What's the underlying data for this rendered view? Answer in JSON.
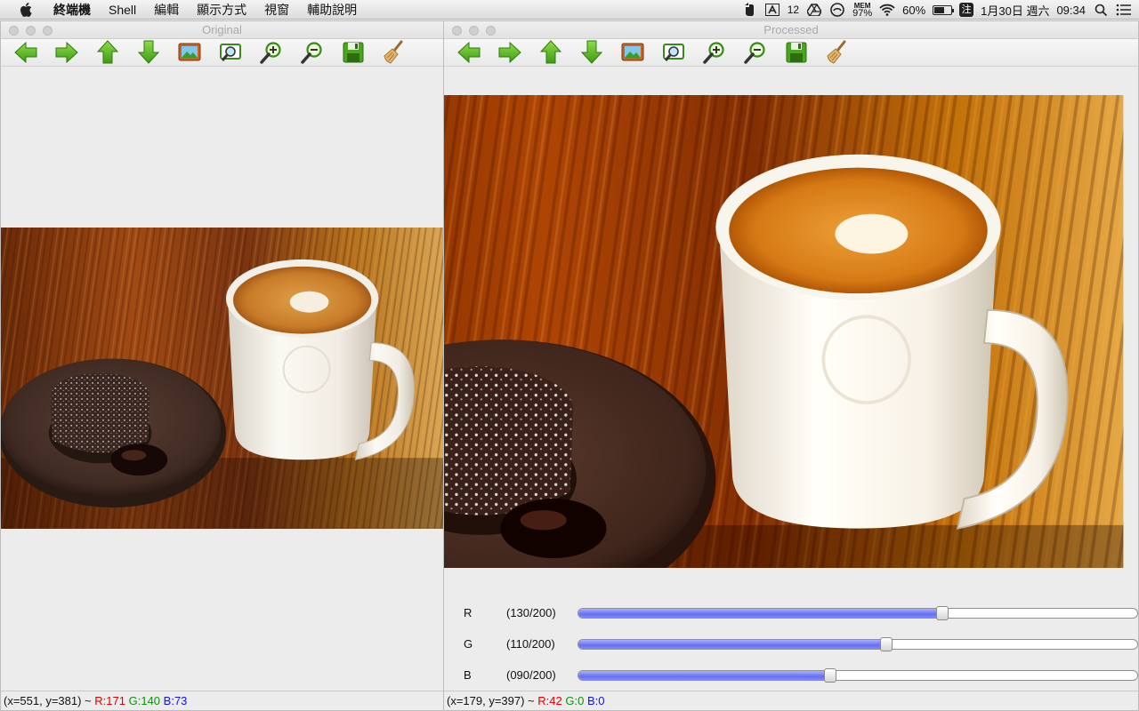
{
  "menubar": {
    "items": [
      "終端機",
      "Shell",
      "編輯",
      "顯示方式",
      "視窗",
      "輔助說明"
    ],
    "tray": {
      "notifications": "12",
      "mem_label": "MEM",
      "mem_value": "97%",
      "battery": "60%",
      "battery_level": 0.6,
      "ime": "注",
      "date": "1月30日 週六",
      "time": "09:34"
    }
  },
  "original_window": {
    "title": "Original",
    "status": {
      "coords": "(x=551, y=381) ~",
      "r": "R:171",
      "g": "G:140",
      "b": "B:73"
    }
  },
  "processed_window": {
    "title": "Processed",
    "status": {
      "coords": "(x=179, y=397) ~",
      "r": "R:42",
      "g": "G:0",
      "b": "B:0"
    },
    "sliders": [
      {
        "label": "R",
        "value_text": "(130/200)",
        "value": 130,
        "max": 200
      },
      {
        "label": "G",
        "value_text": "(110/200)",
        "value": 110,
        "max": 200
      },
      {
        "label": "B",
        "value_text": "(090/200)",
        "value": 90,
        "max": 200
      }
    ]
  },
  "toolbar_icons": [
    "arrow-left-icon",
    "arrow-right-icon",
    "arrow-up-icon",
    "arrow-down-icon",
    "image-icon",
    "zoom-fit-icon",
    "zoom-in-icon",
    "zoom-out-icon",
    "save-icon",
    "broom-icon"
  ],
  "colors": {
    "slider_fill": "#6570f2",
    "arrow_green": "#4caf1e",
    "status_r": "#e00000",
    "status_g": "#109010",
    "status_b": "#1010ee"
  }
}
